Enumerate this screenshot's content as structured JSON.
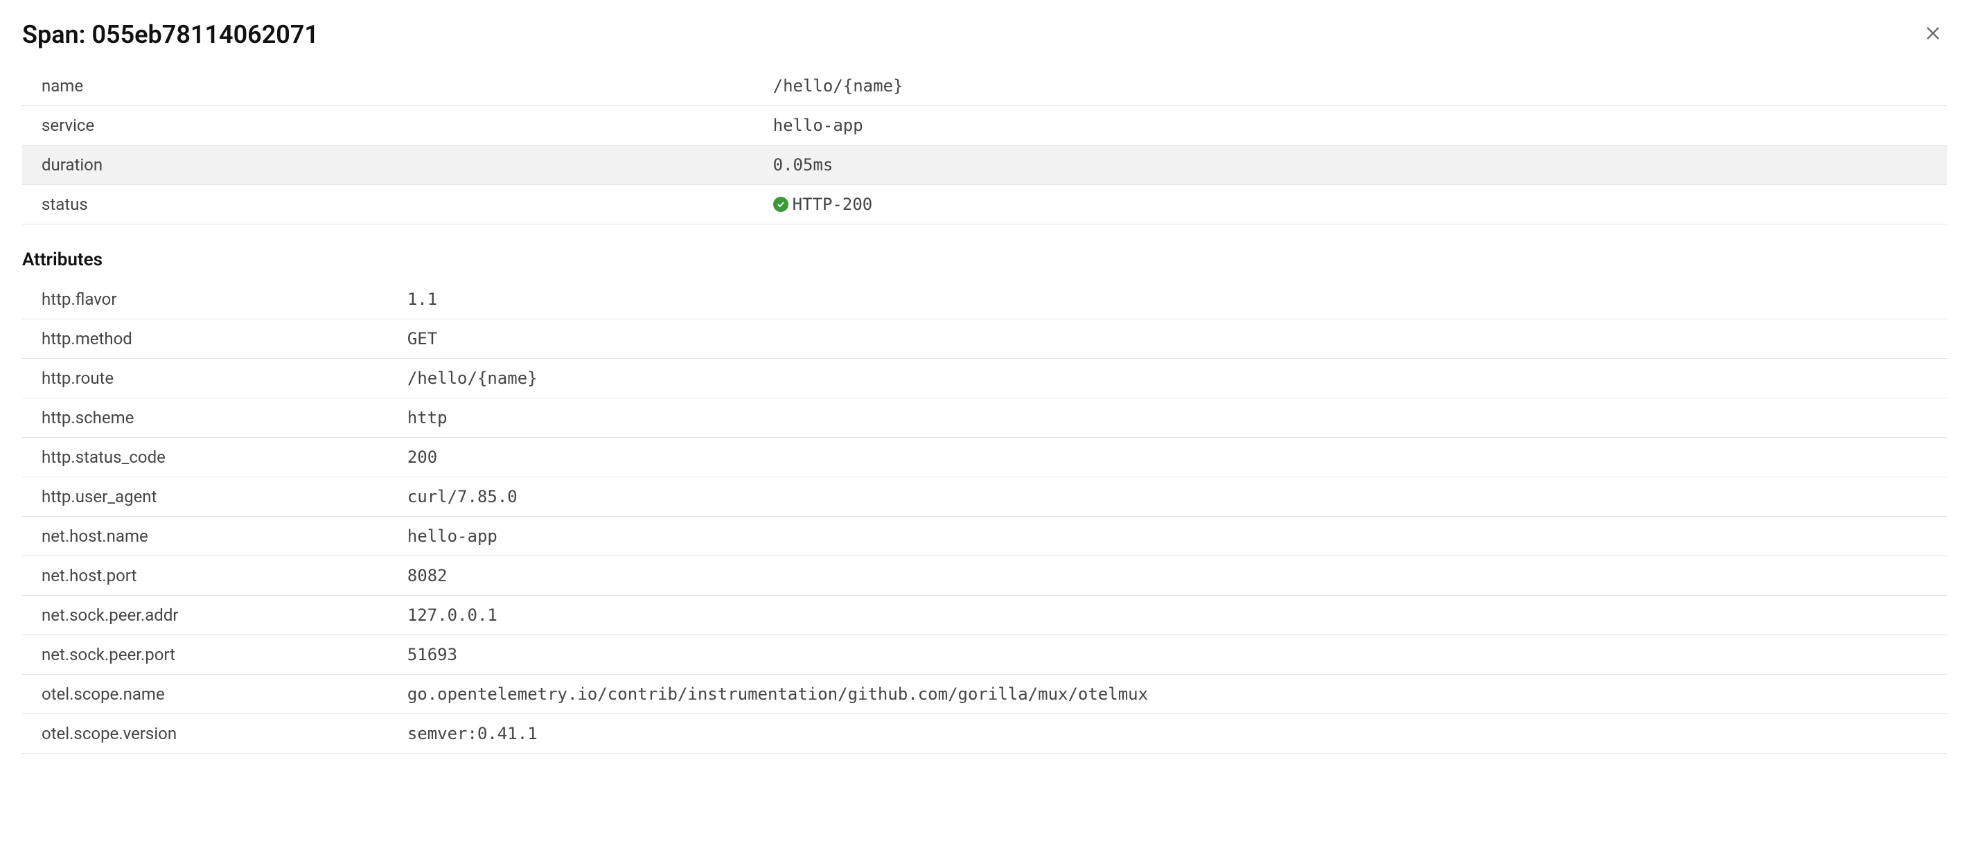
{
  "header": {
    "title_prefix": "Span: ",
    "span_id": "055eb78114062071"
  },
  "details": {
    "name_label": "name",
    "name_value": "/hello/{name}",
    "service_label": "service",
    "service_value": "hello-app",
    "duration_label": "duration",
    "duration_value": "0.05ms",
    "status_label": "status",
    "status_value": "HTTP-200"
  },
  "attributes_section_title": "Attributes",
  "attributes": [
    {
      "key": "http.flavor",
      "value": "1.1"
    },
    {
      "key": "http.method",
      "value": "GET"
    },
    {
      "key": "http.route",
      "value": "/hello/{name}"
    },
    {
      "key": "http.scheme",
      "value": "http"
    },
    {
      "key": "http.status_code",
      "value": "200"
    },
    {
      "key": "http.user_agent",
      "value": "curl/7.85.0"
    },
    {
      "key": "net.host.name",
      "value": "hello-app"
    },
    {
      "key": "net.host.port",
      "value": "8082"
    },
    {
      "key": "net.sock.peer.addr",
      "value": "127.0.0.1"
    },
    {
      "key": "net.sock.peer.port",
      "value": "51693"
    },
    {
      "key": "otel.scope.name",
      "value": "go.opentelemetry.io/contrib/instrumentation/github.com/gorilla/mux/otelmux"
    },
    {
      "key": "otel.scope.version",
      "value": "semver:0.41.1"
    }
  ]
}
